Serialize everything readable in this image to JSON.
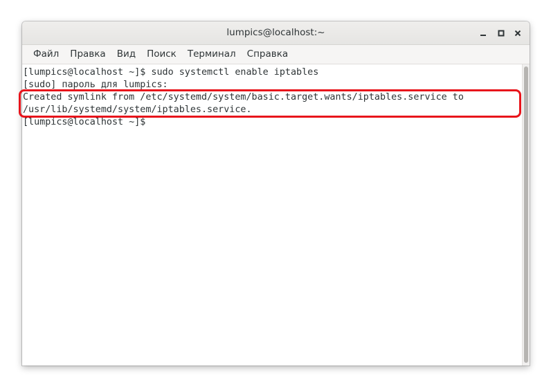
{
  "window": {
    "title": "lumpics@localhost:~"
  },
  "menubar": {
    "items": [
      {
        "label": "Файл"
      },
      {
        "label": "Правка"
      },
      {
        "label": "Вид"
      },
      {
        "label": "Поиск"
      },
      {
        "label": "Терминал"
      },
      {
        "label": "Справка"
      }
    ]
  },
  "terminal": {
    "lines": [
      "[lumpics@localhost ~]$ sudo systemctl enable iptables",
      "[sudo] пароль для lumpics:",
      "Created symlink from /etc/systemd/system/basic.target.wants/iptables.service to",
      "/usr/lib/systemd/system/iptables.service.",
      "[lumpics@localhost ~]$"
    ]
  },
  "icons": {
    "minimize": "minimize-icon",
    "maximize": "maximize-icon",
    "close": "close-icon"
  },
  "colors": {
    "highlight": "#e8141b",
    "terminal_bg": "#ffffff",
    "text": "#2e3436"
  }
}
